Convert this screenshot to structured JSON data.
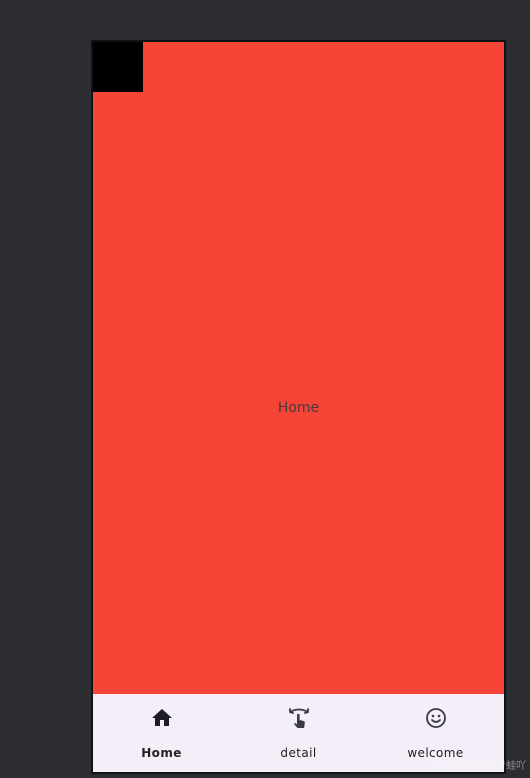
{
  "screen": {
    "center_text": "Home",
    "background_color": "#f64436"
  },
  "bottom_nav": {
    "items": [
      {
        "label": "Home",
        "icon": "home-icon",
        "selected": true
      },
      {
        "label": "detail",
        "icon": "touch-swipe-icon",
        "selected": false
      },
      {
        "label": "welcome",
        "icon": "smiley-icon",
        "selected": false
      }
    ],
    "background_color": "#f3eef7"
  },
  "watermark": "CSDN @小小青蛙吖"
}
